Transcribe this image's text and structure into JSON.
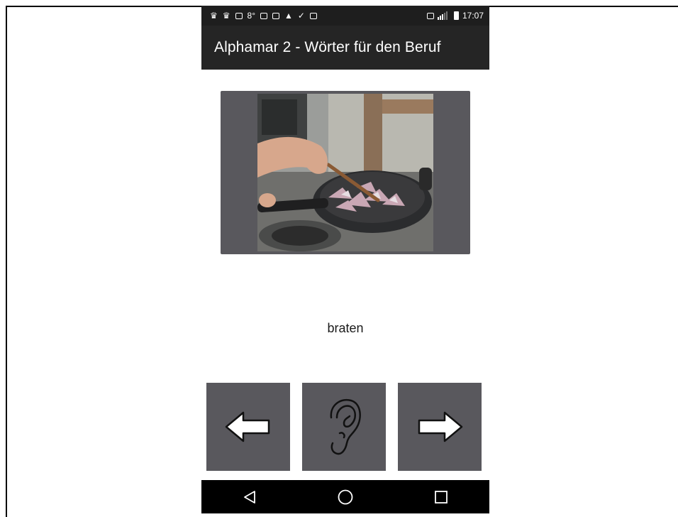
{
  "status_bar": {
    "temperature": "8°",
    "time": "17:07",
    "icons": [
      "app-notification-icon",
      "app-notification-icon",
      "image-icon",
      "weather-icon",
      "instagram-icon",
      "instagram-icon",
      "navigation-icon",
      "download-done-icon",
      "clipboard-icon",
      "nfc-icon",
      "signal-icon",
      "battery-icon"
    ]
  },
  "app_bar": {
    "title": "Alphamar 2 - Wörter für den Beruf"
  },
  "card": {
    "image_icon": "photo-frying-onions",
    "word": "braten"
  },
  "controls": {
    "previous_icon": "arrow-left-icon",
    "listen_icon": "ear-icon",
    "next_icon": "arrow-right-icon"
  },
  "nav_bar": {
    "back_icon": "back-triangle-icon",
    "home_icon": "home-circle-icon",
    "recents_icon": "recents-square-icon"
  },
  "colors": {
    "app_bar": "#252525",
    "status_bar": "#1e1e1e",
    "button_gray": "#59585d",
    "nav_bar": "#000000"
  }
}
